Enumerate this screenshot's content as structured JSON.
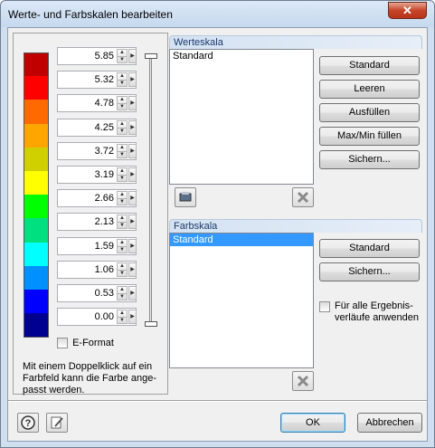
{
  "window": {
    "title": "Werte- und Farbskalen bearbeiten"
  },
  "scale": {
    "colors": [
      "#c00000",
      "#ff0000",
      "#ff6a00",
      "#ffa500",
      "#d0d000",
      "#ffff00",
      "#00ff00",
      "#00e080",
      "#00ffff",
      "#0090ff",
      "#0000ff",
      "#000090"
    ],
    "values": [
      "5.85",
      "5.32",
      "4.78",
      "4.25",
      "3.72",
      "3.19",
      "2.66",
      "2.13",
      "1.59",
      "1.06",
      "0.53",
      "0.00"
    ],
    "eformat_label": "E-Format",
    "hint": "Mit einem Doppelklick auf ein Farbfeld kann die Farbe ange-passt werden."
  },
  "werteskala": {
    "title": "Werteskala",
    "items": [
      "Standard"
    ],
    "buttons": [
      "Standard",
      "Leeren",
      "Ausfüllen",
      "Max/Min füllen",
      "Sichern..."
    ]
  },
  "farbskala": {
    "title": "Farbskala",
    "items": [
      "Standard"
    ],
    "buttons": [
      "Standard",
      "Sichern..."
    ],
    "apply_all_label": "Für alle Ergebnis-verläufe anwenden"
  },
  "footer": {
    "ok": "OK",
    "cancel": "Abbrechen"
  }
}
